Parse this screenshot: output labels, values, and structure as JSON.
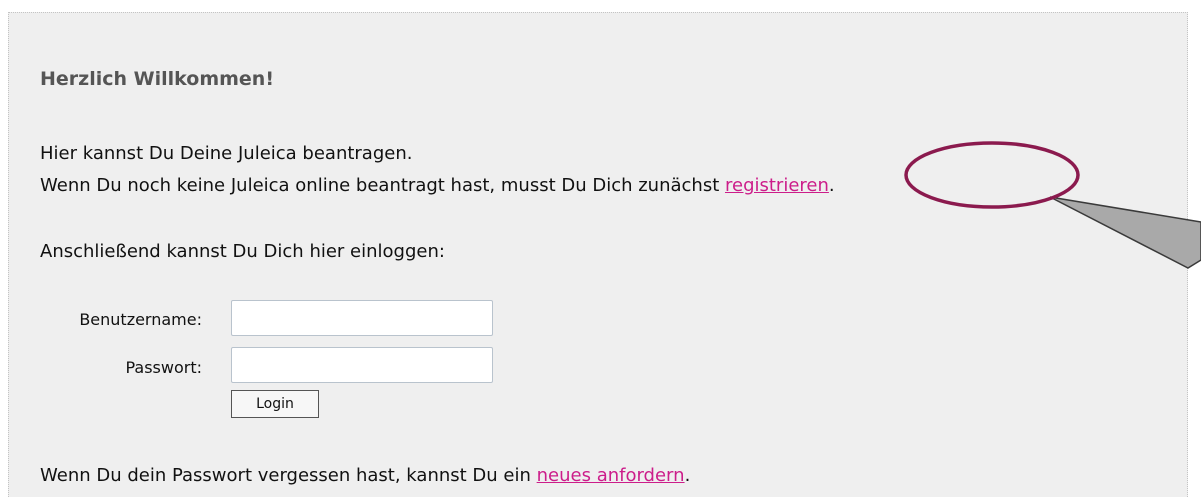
{
  "welcome": {
    "heading": "Herzlich Willkommen!",
    "line1": "Hier kannst Du Deine Juleica beantragen.",
    "line2_prefix": "Wenn Du noch keine Juleica online beantragt hast, musst Du Dich zunächst ",
    "register_link": "registrieren",
    "line2_suffix": ".",
    "line3": "Anschließend kannst Du Dich hier einloggen:"
  },
  "login": {
    "username_label": "Benutzername:",
    "password_label": "Passwort:",
    "button_label": "Login"
  },
  "forgot": {
    "prefix": "Wenn Du dein Passwort vergessen hast, kannst Du ein ",
    "link": "neues anfordern",
    "suffix": "."
  },
  "colors": {
    "link": "#cc1d8a",
    "annotation_ellipse": "#8b1a4e",
    "callout_fill": "#a9a9a9"
  }
}
